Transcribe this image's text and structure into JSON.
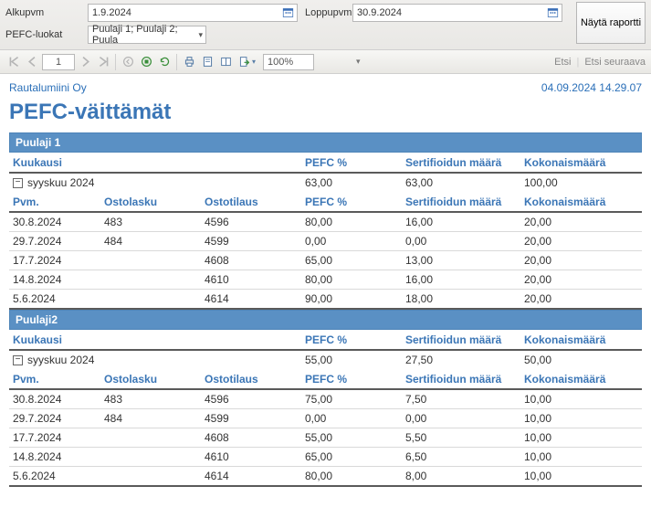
{
  "filters": {
    "start_label": "Alkupvm",
    "end_label": "Loppupvm",
    "pefc_label": "PEFC-luokat",
    "start_value": "1.9.2024",
    "end_value": "30.9.2024",
    "pefc_value": "Puulaji 1; Puulaji 2; Puula",
    "run_button": "Näytä raportti"
  },
  "toolbar": {
    "page": "1",
    "zoom": "100%",
    "find": "Etsi",
    "find_next": "Etsi seuraava"
  },
  "report": {
    "company": "Rautalumiini Oy",
    "timestamp": "04.09.2024 14.29.07",
    "title": "PEFC-väittämät"
  },
  "month_headers": {
    "kuukausi": "Kuukausi",
    "pefc": "PEFC %",
    "sert": "Sertifioidun määrä",
    "koko": "Kokonaismäärä"
  },
  "detail_headers": {
    "pvm": "Pvm.",
    "ostolasku": "Ostolasku",
    "ostotilaus": "Ostotilaus",
    "pefc": "PEFC %",
    "sert": "Sertifioidun määrä",
    "koko": "Kokonaismäärä"
  },
  "species": [
    {
      "name": "Puulaji 1",
      "month": {
        "label": "syyskuu 2024",
        "pefc": "63,00",
        "sert": "63,00",
        "koko": "100,00"
      },
      "rows": [
        {
          "pvm": "30.8.2024",
          "ostolasku": "483",
          "ostotilaus": "4596",
          "pefc": "80,00",
          "sert": "16,00",
          "koko": "20,00"
        },
        {
          "pvm": "29.7.2024",
          "ostolasku": "484",
          "ostotilaus": "4599",
          "pefc": "0,00",
          "sert": "0,00",
          "koko": "20,00"
        },
        {
          "pvm": "17.7.2024",
          "ostolasku": "",
          "ostotilaus": "4608",
          "pefc": "65,00",
          "sert": "13,00",
          "koko": "20,00"
        },
        {
          "pvm": "14.8.2024",
          "ostolasku": "",
          "ostotilaus": "4610",
          "pefc": "80,00",
          "sert": "16,00",
          "koko": "20,00"
        },
        {
          "pvm": "5.6.2024",
          "ostolasku": "",
          "ostotilaus": "4614",
          "pefc": "90,00",
          "sert": "18,00",
          "koko": "20,00"
        }
      ]
    },
    {
      "name": "Puulaji2",
      "month": {
        "label": "syyskuu 2024",
        "pefc": "55,00",
        "sert": "27,50",
        "koko": "50,00"
      },
      "rows": [
        {
          "pvm": "30.8.2024",
          "ostolasku": "483",
          "ostotilaus": "4596",
          "pefc": "75,00",
          "sert": "7,50",
          "koko": "10,00"
        },
        {
          "pvm": "29.7.2024",
          "ostolasku": "484",
          "ostotilaus": "4599",
          "pefc": "0,00",
          "sert": "0,00",
          "koko": "10,00"
        },
        {
          "pvm": "17.7.2024",
          "ostolasku": "",
          "ostotilaus": "4608",
          "pefc": "55,00",
          "sert": "5,50",
          "koko": "10,00"
        },
        {
          "pvm": "14.8.2024",
          "ostolasku": "",
          "ostotilaus": "4610",
          "pefc": "65,00",
          "sert": "6,50",
          "koko": "10,00"
        },
        {
          "pvm": "5.6.2024",
          "ostolasku": "",
          "ostotilaus": "4614",
          "pefc": "80,00",
          "sert": "8,00",
          "koko": "10,00"
        }
      ]
    }
  ]
}
